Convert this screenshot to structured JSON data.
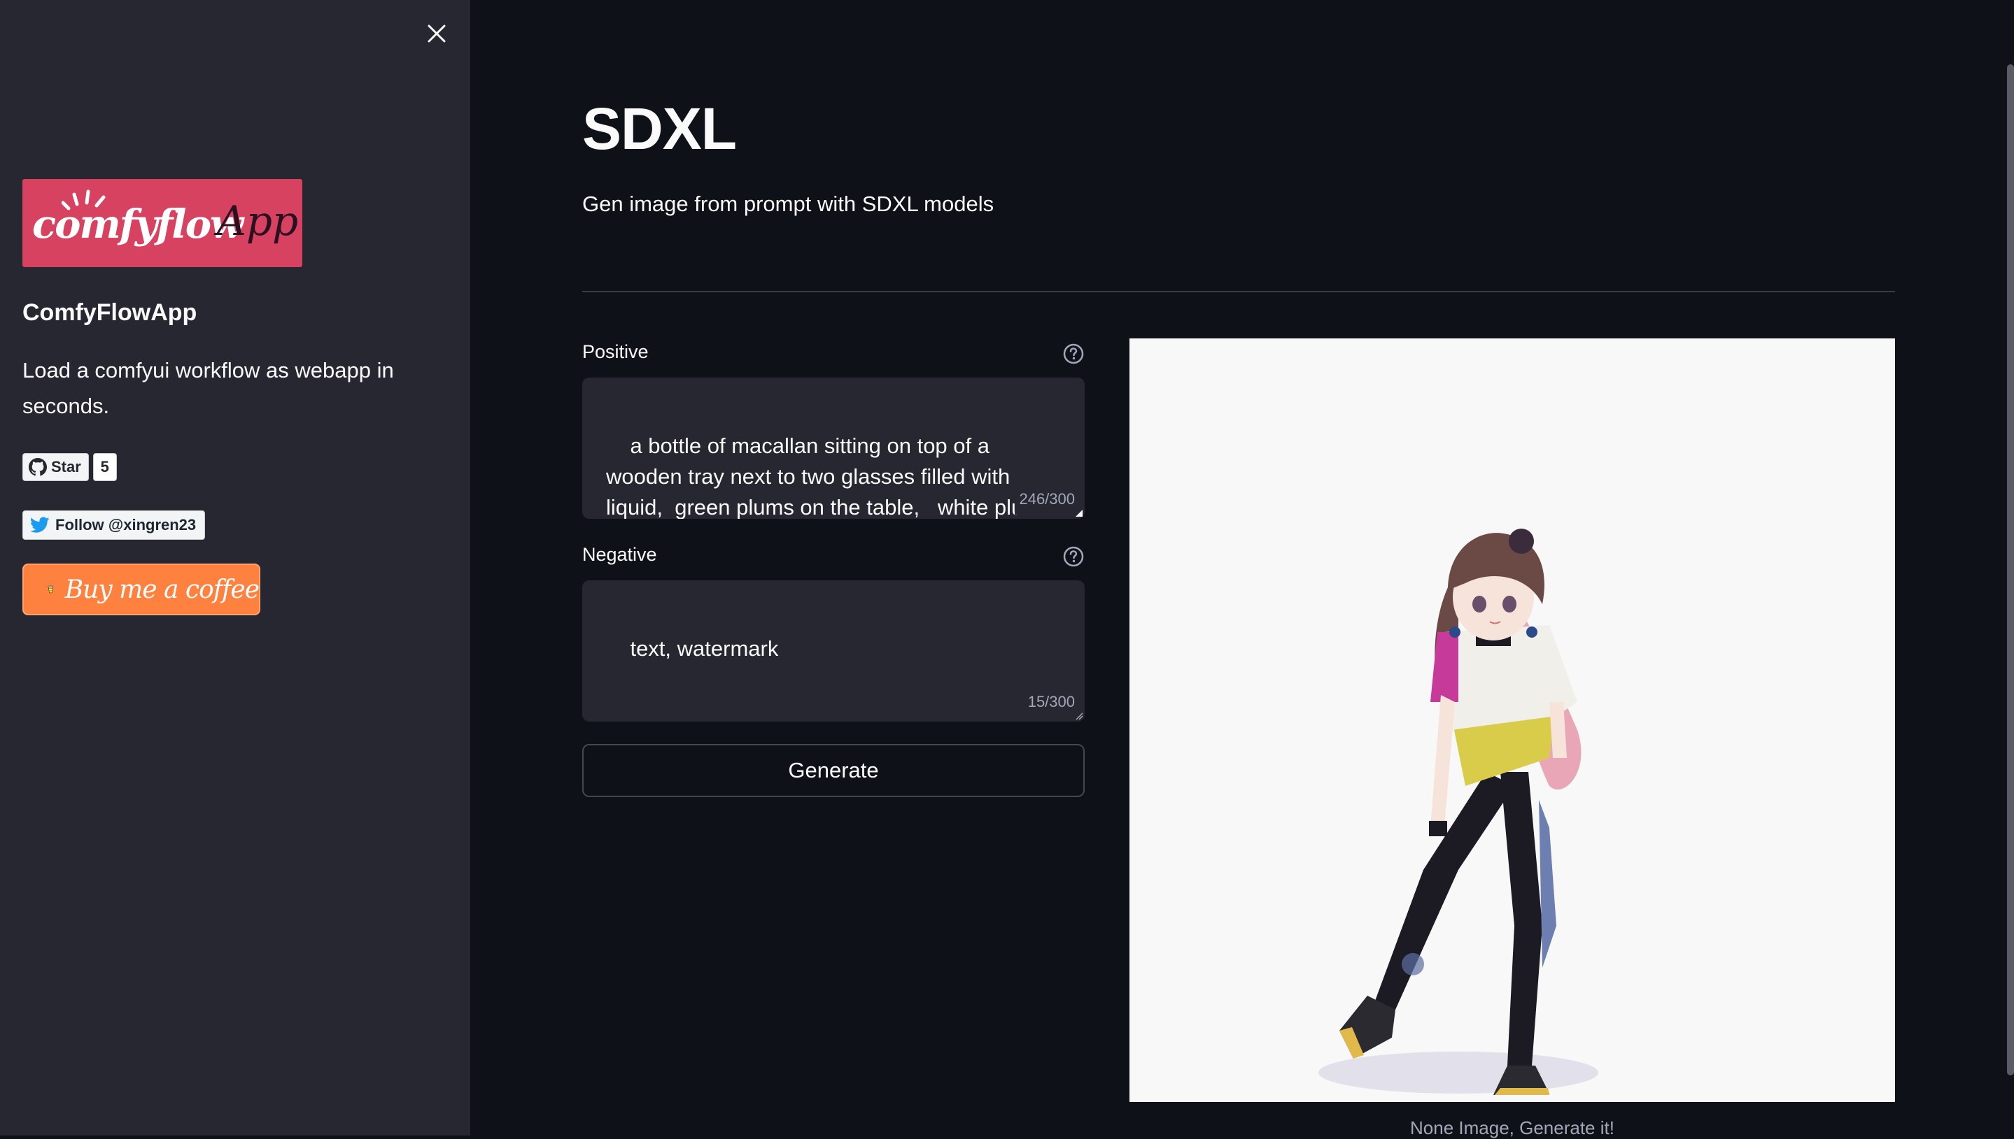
{
  "sidebar": {
    "close_icon": "close-icon",
    "logo": {
      "word": "comfyflow",
      "app": "App",
      "bg_color": "#d6425f"
    },
    "app_title": "ComfyFlowApp",
    "description": "Load a comfyui workflow as webapp in seconds.",
    "github": {
      "icon": "github-icon",
      "label": "Star",
      "count": "5"
    },
    "twitter": {
      "icon": "twitter-bird-icon",
      "label": "Follow @xingren23"
    },
    "buy_coffee": {
      "icon": "coffee-cup-icon",
      "label": "Buy me a coffee",
      "bg_color": "#ff813f"
    }
  },
  "main": {
    "title": "SDXL",
    "subtitle": "Gen image from prompt with SDXL models",
    "positive": {
      "label": "Positive",
      "help_icon": "question-circle-icon",
      "value": "a bottle of macallan sitting on top of a wooden tray next to two glasses filled with liquid,  green plums on the table,   white plum blossom,sunlight,grove,chinese wood",
      "char_count": "246/300"
    },
    "negative": {
      "label": "Negative",
      "help_icon": "question-circle-icon",
      "value": "text, watermark",
      "char_count": "15/300"
    },
    "generate_label": "Generate",
    "image_caption": "None Image, Generate it!"
  },
  "colors": {
    "app_bg": "#0e1117",
    "sidebar_bg": "#262730",
    "input_bg": "#262730",
    "text": "#fafafa",
    "muted_text": "#a3a8b8"
  }
}
